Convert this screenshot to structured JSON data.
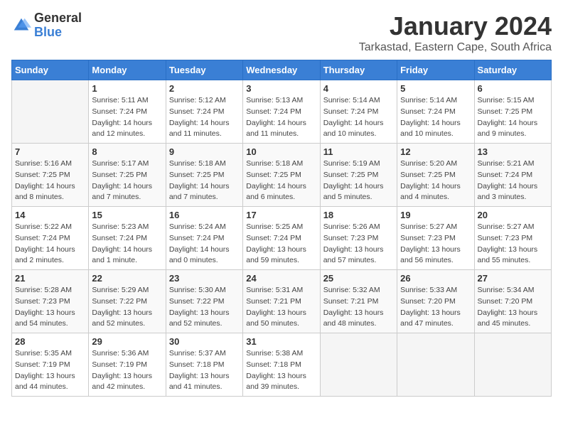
{
  "logo": {
    "general": "General",
    "blue": "Blue"
  },
  "title": "January 2024",
  "subtitle": "Tarkastad, Eastern Cape, South Africa",
  "days_of_week": [
    "Sunday",
    "Monday",
    "Tuesday",
    "Wednesday",
    "Thursday",
    "Friday",
    "Saturday"
  ],
  "weeks": [
    [
      {
        "day": "",
        "info": ""
      },
      {
        "day": "1",
        "info": "Sunrise: 5:11 AM\nSunset: 7:24 PM\nDaylight: 14 hours\nand 12 minutes."
      },
      {
        "day": "2",
        "info": "Sunrise: 5:12 AM\nSunset: 7:24 PM\nDaylight: 14 hours\nand 11 minutes."
      },
      {
        "day": "3",
        "info": "Sunrise: 5:13 AM\nSunset: 7:24 PM\nDaylight: 14 hours\nand 11 minutes."
      },
      {
        "day": "4",
        "info": "Sunrise: 5:14 AM\nSunset: 7:24 PM\nDaylight: 14 hours\nand 10 minutes."
      },
      {
        "day": "5",
        "info": "Sunrise: 5:14 AM\nSunset: 7:24 PM\nDaylight: 14 hours\nand 10 minutes."
      },
      {
        "day": "6",
        "info": "Sunrise: 5:15 AM\nSunset: 7:25 PM\nDaylight: 14 hours\nand 9 minutes."
      }
    ],
    [
      {
        "day": "7",
        "info": "Sunrise: 5:16 AM\nSunset: 7:25 PM\nDaylight: 14 hours\nand 8 minutes."
      },
      {
        "day": "8",
        "info": "Sunrise: 5:17 AM\nSunset: 7:25 PM\nDaylight: 14 hours\nand 7 minutes."
      },
      {
        "day": "9",
        "info": "Sunrise: 5:18 AM\nSunset: 7:25 PM\nDaylight: 14 hours\nand 7 minutes."
      },
      {
        "day": "10",
        "info": "Sunrise: 5:18 AM\nSunset: 7:25 PM\nDaylight: 14 hours\nand 6 minutes."
      },
      {
        "day": "11",
        "info": "Sunrise: 5:19 AM\nSunset: 7:25 PM\nDaylight: 14 hours\nand 5 minutes."
      },
      {
        "day": "12",
        "info": "Sunrise: 5:20 AM\nSunset: 7:25 PM\nDaylight: 14 hours\nand 4 minutes."
      },
      {
        "day": "13",
        "info": "Sunrise: 5:21 AM\nSunset: 7:24 PM\nDaylight: 14 hours\nand 3 minutes."
      }
    ],
    [
      {
        "day": "14",
        "info": "Sunrise: 5:22 AM\nSunset: 7:24 PM\nDaylight: 14 hours\nand 2 minutes."
      },
      {
        "day": "15",
        "info": "Sunrise: 5:23 AM\nSunset: 7:24 PM\nDaylight: 14 hours\nand 1 minute."
      },
      {
        "day": "16",
        "info": "Sunrise: 5:24 AM\nSunset: 7:24 PM\nDaylight: 14 hours\nand 0 minutes."
      },
      {
        "day": "17",
        "info": "Sunrise: 5:25 AM\nSunset: 7:24 PM\nDaylight: 13 hours\nand 59 minutes."
      },
      {
        "day": "18",
        "info": "Sunrise: 5:26 AM\nSunset: 7:23 PM\nDaylight: 13 hours\nand 57 minutes."
      },
      {
        "day": "19",
        "info": "Sunrise: 5:27 AM\nSunset: 7:23 PM\nDaylight: 13 hours\nand 56 minutes."
      },
      {
        "day": "20",
        "info": "Sunrise: 5:27 AM\nSunset: 7:23 PM\nDaylight: 13 hours\nand 55 minutes."
      }
    ],
    [
      {
        "day": "21",
        "info": "Sunrise: 5:28 AM\nSunset: 7:23 PM\nDaylight: 13 hours\nand 54 minutes."
      },
      {
        "day": "22",
        "info": "Sunrise: 5:29 AM\nSunset: 7:22 PM\nDaylight: 13 hours\nand 52 minutes."
      },
      {
        "day": "23",
        "info": "Sunrise: 5:30 AM\nSunset: 7:22 PM\nDaylight: 13 hours\nand 52 minutes."
      },
      {
        "day": "24",
        "info": "Sunrise: 5:31 AM\nSunset: 7:21 PM\nDaylight: 13 hours\nand 50 minutes."
      },
      {
        "day": "25",
        "info": "Sunrise: 5:32 AM\nSunset: 7:21 PM\nDaylight: 13 hours\nand 48 minutes."
      },
      {
        "day": "26",
        "info": "Sunrise: 5:33 AM\nSunset: 7:20 PM\nDaylight: 13 hours\nand 47 minutes."
      },
      {
        "day": "27",
        "info": "Sunrise: 5:34 AM\nSunset: 7:20 PM\nDaylight: 13 hours\nand 45 minutes."
      }
    ],
    [
      {
        "day": "28",
        "info": "Sunrise: 5:35 AM\nSunset: 7:19 PM\nDaylight: 13 hours\nand 44 minutes."
      },
      {
        "day": "29",
        "info": "Sunrise: 5:36 AM\nSunset: 7:19 PM\nDaylight: 13 hours\nand 42 minutes."
      },
      {
        "day": "30",
        "info": "Sunrise: 5:37 AM\nSunset: 7:18 PM\nDaylight: 13 hours\nand 41 minutes."
      },
      {
        "day": "31",
        "info": "Sunrise: 5:38 AM\nSunset: 7:18 PM\nDaylight: 13 hours\nand 39 minutes."
      },
      {
        "day": "",
        "info": ""
      },
      {
        "day": "",
        "info": ""
      },
      {
        "day": "",
        "info": ""
      }
    ]
  ]
}
